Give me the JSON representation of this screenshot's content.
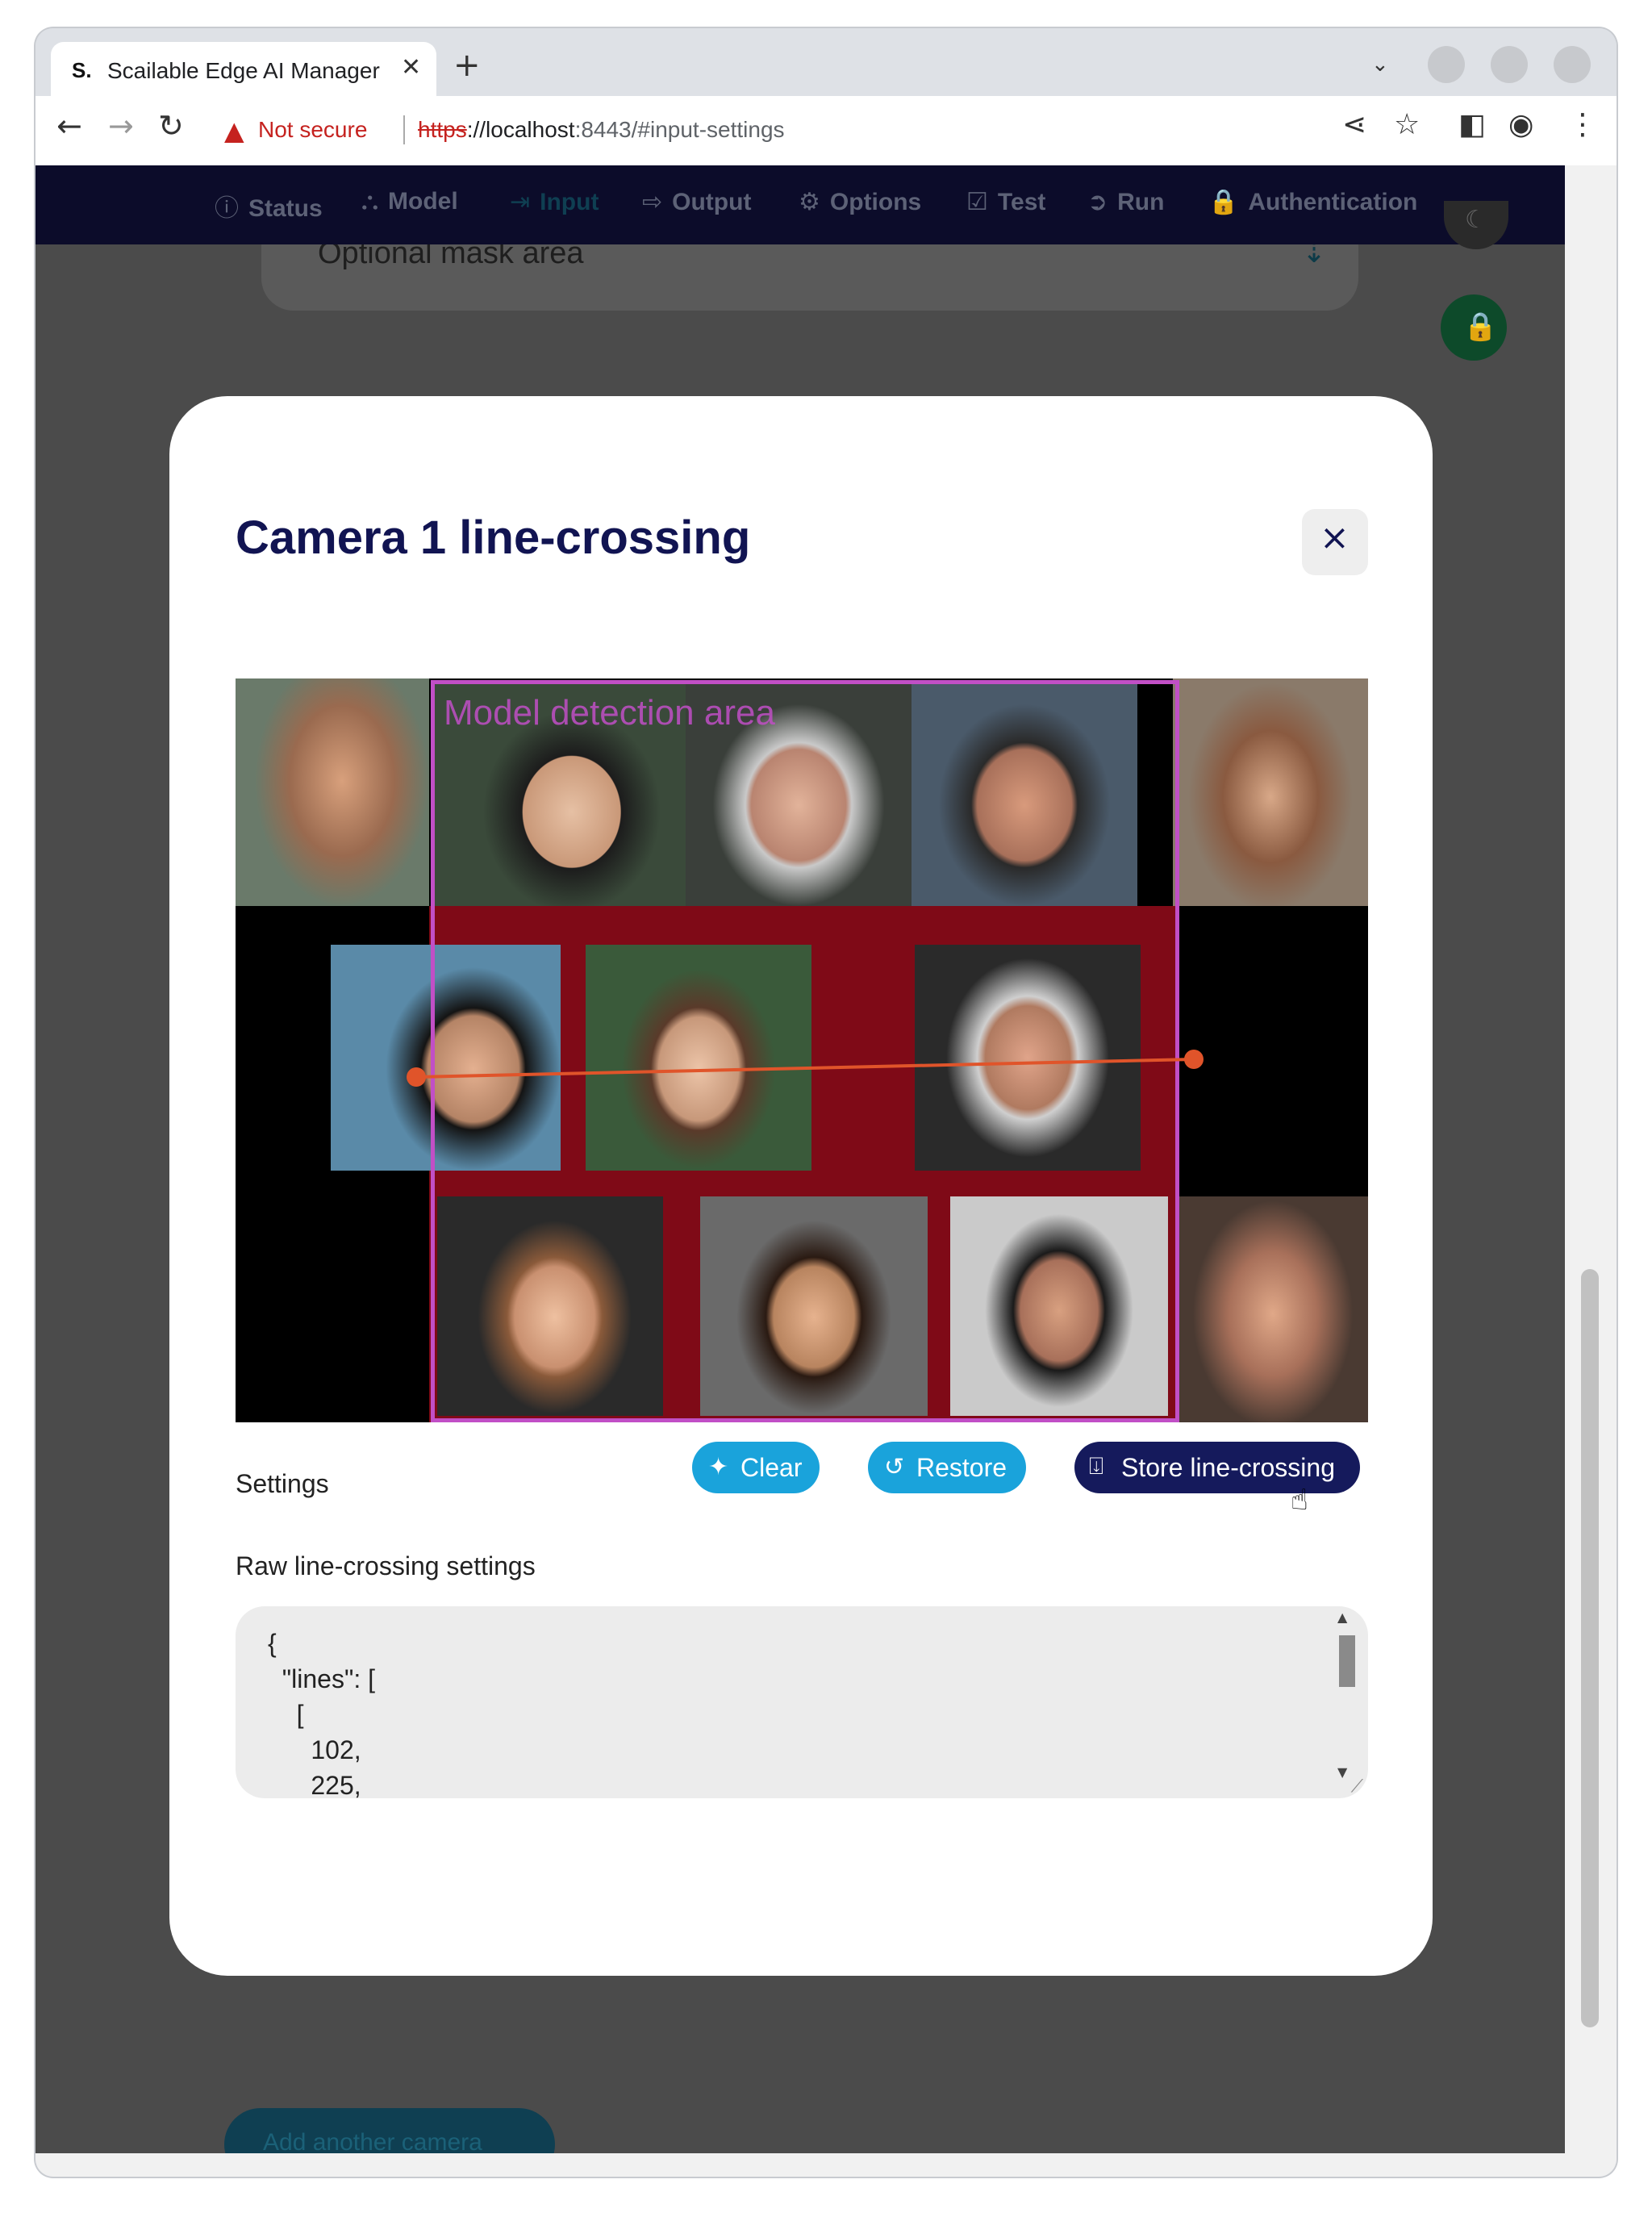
{
  "browser": {
    "tab_favicon": "S.",
    "tab_title": "Scailable Edge AI Manager",
    "tab_close": "✕",
    "new_tab": "+",
    "tab_menu": "⌄",
    "security_warning": "Not secure",
    "url_scheme": "https",
    "url_host": "://localhost",
    "url_rest": ":8443/#input-settings"
  },
  "nav": {
    "items": [
      {
        "icon": "ⓘ",
        "label": "Status"
      },
      {
        "icon": "⛬",
        "label": "Model"
      },
      {
        "icon": "⇥",
        "label": "Input"
      },
      {
        "icon": "⇨",
        "label": "Output"
      },
      {
        "icon": "⚙",
        "label": "Options"
      },
      {
        "icon": "☑",
        "label": "Test"
      },
      {
        "icon": "➲",
        "label": "Run"
      },
      {
        "icon": "🔒",
        "label": "Authentication"
      }
    ]
  },
  "background": {
    "panel_title": "Optional mask area",
    "add_camera": "Add another camera"
  },
  "modal": {
    "title": "Camera 1 line-crossing",
    "close": "×",
    "detection_label": "Model detection area",
    "settings_label": "Settings",
    "clear_label": "Clear",
    "restore_label": "Restore",
    "store_label": "Store line-crossing",
    "raw_label": "Raw line-crossing settings",
    "raw_json": "{\n  \"lines\": [\n    [\n      102,\n      225,"
  },
  "colors": {
    "nav_bg": "#0c0c2a",
    "title": "#111452",
    "pill_blue": "#1aa3db",
    "pill_dark": "#151a5c",
    "detection_box": "#c14fc6",
    "line": "#e0542a"
  }
}
